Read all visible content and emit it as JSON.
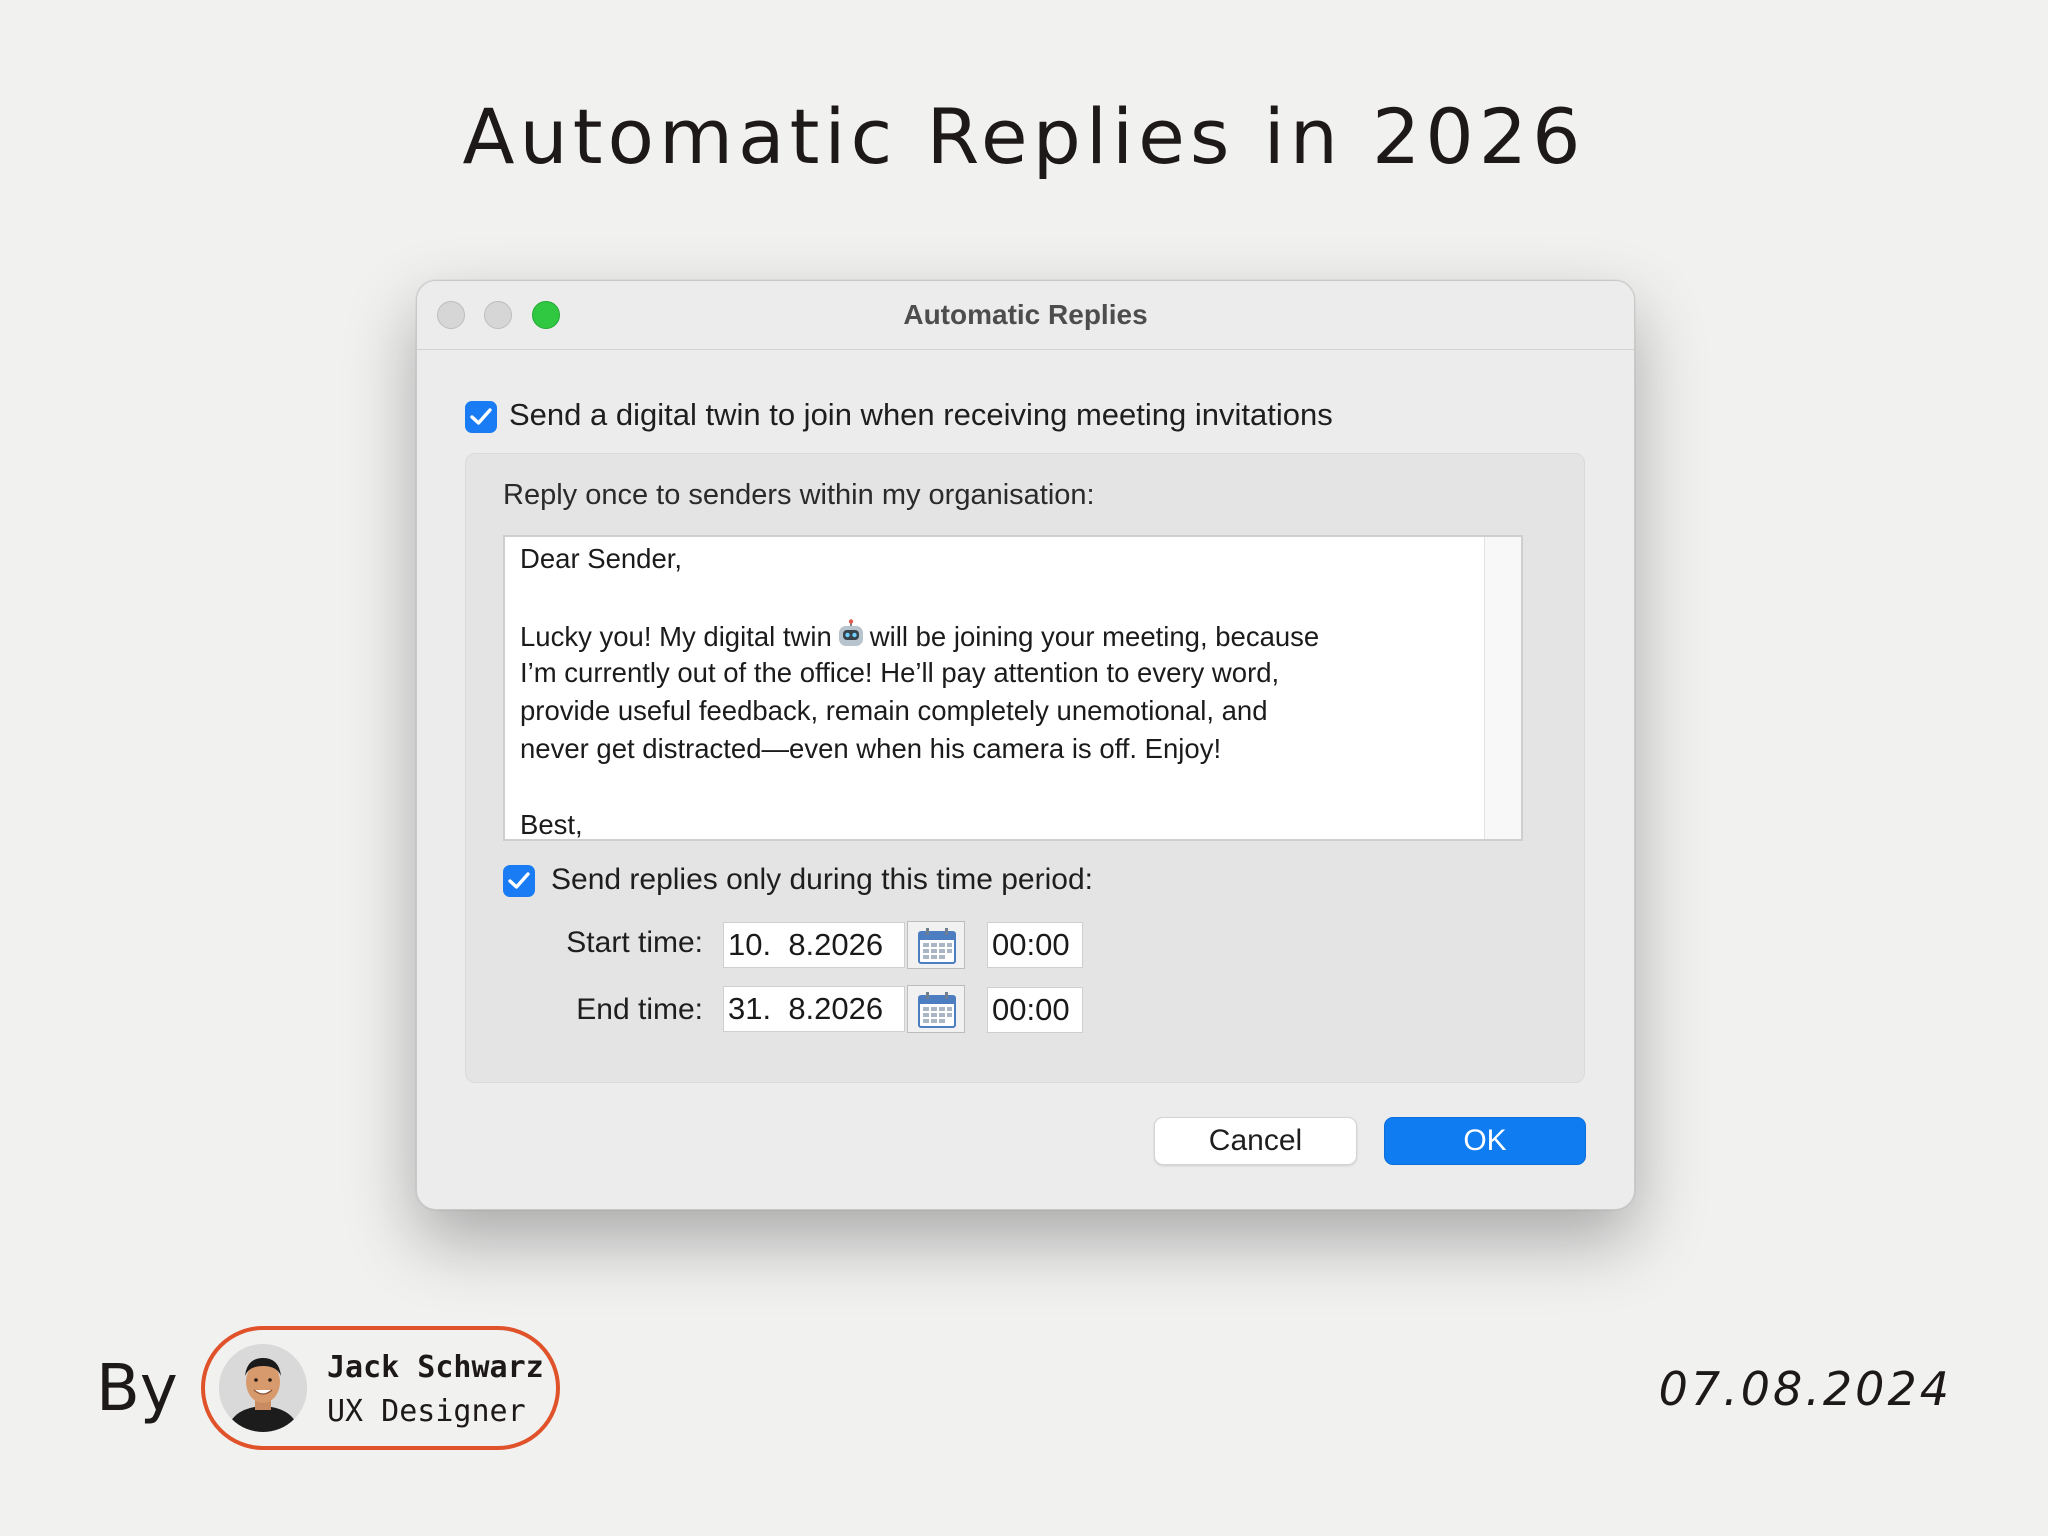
{
  "page": {
    "title": "Automatic Replies in 2026",
    "by_label": "By",
    "author_name": "Jack Schwarz",
    "author_role": "UX Designer",
    "date": "07.08.2024",
    "accent_color": "#e0522a"
  },
  "window": {
    "title": "Automatic Replies",
    "traffic_lights": [
      "close",
      "minimize",
      "maximize"
    ]
  },
  "dialog": {
    "digital_twin_checkbox": {
      "label": "Send a digital twin to join when receiving meeting invitations",
      "checked": true
    },
    "reply_label": "Reply once to senders within my organisation:",
    "message": {
      "greeting": "Dear Sender,",
      "body_line1_a": "Lucky you! My digital twin",
      "body_line1_b": "will be joining your meeting, because",
      "body_line2": "I’m currently out of the office! He’ll pay attention to every word,",
      "body_line3": "provide useful feedback, remain completely unemotional, and",
      "body_line4": "never get distracted—even when his camera is off. Enjoy!",
      "signoff": "Best,"
    },
    "time_period_checkbox": {
      "label": "Send replies only during this time period:",
      "checked": true
    },
    "start": {
      "label": "Start time:",
      "date": "10.  8.2026",
      "time": "00:00"
    },
    "end": {
      "label": "End time:",
      "date": "31.  8.2026",
      "time": "00:00"
    },
    "buttons": {
      "cancel": "Cancel",
      "ok": "OK"
    },
    "checkbox_color": "#1a7cf5",
    "primary_button_color": "#0f7cf2"
  }
}
